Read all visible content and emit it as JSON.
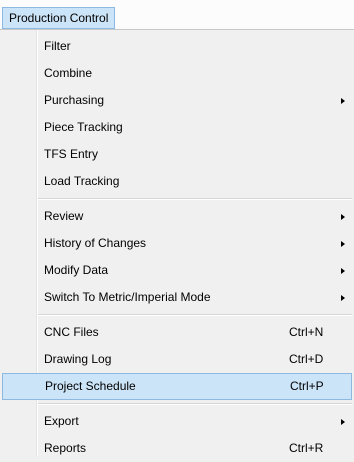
{
  "menubar": {
    "title": "Production Control"
  },
  "menu": {
    "groups": [
      [
        {
          "label": "Filter",
          "shortcut": "",
          "submenu": false
        },
        {
          "label": "Combine",
          "shortcut": "",
          "submenu": false
        },
        {
          "label": "Purchasing",
          "shortcut": "",
          "submenu": true
        },
        {
          "label": "Piece Tracking",
          "shortcut": "",
          "submenu": false
        },
        {
          "label": "TFS Entry",
          "shortcut": "",
          "submenu": false
        },
        {
          "label": "Load Tracking",
          "shortcut": "",
          "submenu": false
        }
      ],
      [
        {
          "label": "Review",
          "shortcut": "",
          "submenu": true
        },
        {
          "label": "History of Changes",
          "shortcut": "",
          "submenu": true
        },
        {
          "label": "Modify Data",
          "shortcut": "",
          "submenu": true
        },
        {
          "label": "Switch To Metric/Imperial Mode",
          "shortcut": "",
          "submenu": true
        }
      ],
      [
        {
          "label": "CNC Files",
          "shortcut": "Ctrl+N",
          "submenu": false
        },
        {
          "label": "Drawing Log",
          "shortcut": "Ctrl+D",
          "submenu": false
        },
        {
          "label": "Project Schedule",
          "shortcut": "Ctrl+P",
          "submenu": false,
          "highlighted": true
        }
      ],
      [
        {
          "label": "Export",
          "shortcut": "",
          "submenu": true
        },
        {
          "label": "Reports",
          "shortcut": "Ctrl+R",
          "submenu": false
        }
      ]
    ]
  },
  "colors": {
    "highlight": "#cce4f7",
    "highlight_border": "#8cb8e2",
    "menu_bg": "#f0f0f0"
  }
}
